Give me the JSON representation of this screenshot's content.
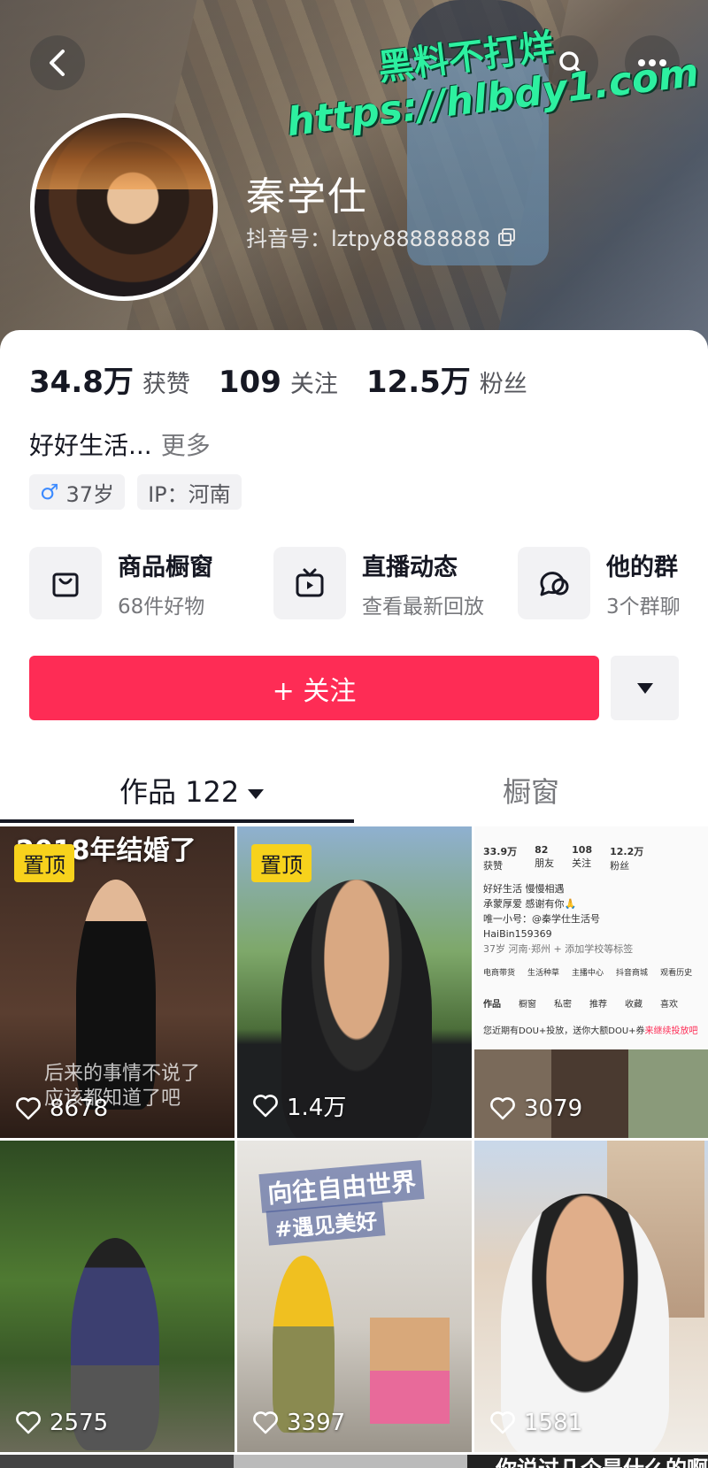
{
  "watermark": {
    "line1": "黑料不打烊",
    "line2": "https://hlbdy1.com"
  },
  "profile": {
    "name": "秦学仕",
    "douyin_id": "抖音号：lztpy88888888"
  },
  "stats": [
    {
      "num": "34.8万",
      "label": "获赞"
    },
    {
      "num": "109",
      "label": "关注"
    },
    {
      "num": "12.5万",
      "label": "粉丝"
    }
  ],
  "bio": {
    "text": "好好生活...",
    "more": "更多"
  },
  "tags": {
    "gender_symbol": "♂",
    "age": "37岁",
    "ip": "IP：河南"
  },
  "features": [
    {
      "title": "商品橱窗",
      "sub": "68件好物",
      "icon": "shopping-bag-icon"
    },
    {
      "title": "直播动态",
      "sub": "查看最新回放",
      "icon": "tv-icon"
    },
    {
      "title": "他的群",
      "sub": "3个群聊",
      "icon": "chat-bubbles-icon"
    }
  ],
  "actions": {
    "follow": "+ 关注"
  },
  "tabs": {
    "works": "作品 122",
    "window": "橱窗"
  },
  "grid": [
    {
      "pin": "置顶",
      "likes": "8678",
      "caption": "2018年结婚了",
      "overlay": "后来的事情不说了\n应该都知道了吧"
    },
    {
      "pin": "置顶",
      "likes": "1.4万"
    },
    {
      "likes": "3079"
    },
    {
      "likes": "2575"
    },
    {
      "likes": "3397",
      "caption": "向往自由世界",
      "hashtag": "#遇见美好"
    },
    {
      "likes": "1581"
    }
  ],
  "mini_screenshot": {
    "stats": [
      {
        "num": "33.9万",
        "label": "获赞"
      },
      {
        "num": "82",
        "label": "朋友"
      },
      {
        "num": "108",
        "label": "关注"
      },
      {
        "num": "12.2万",
        "label": "粉丝"
      }
    ],
    "bio1": "好好生活  慢慢相遇",
    "bio2": "承蒙厚爱  感谢有你🙏",
    "bio3": "唯一小号：@秦学仕生活号",
    "bio4": "HaiBin159369",
    "tags": "37岁  河南·郑州  + 添加学校等标签",
    "menu": [
      "电商带货",
      "生活种草",
      "主播中心",
      "抖音商城",
      "观看历史"
    ],
    "tabs": [
      "作品",
      "橱窗",
      "私密",
      "推荐",
      "收藏",
      "喜欢"
    ],
    "notice": "您近期有DOU+投放，送你大额DOU+券",
    "notice_link": "来继续投放吧"
  },
  "bottom_strip_text": "你说过几个是什么的啊"
}
